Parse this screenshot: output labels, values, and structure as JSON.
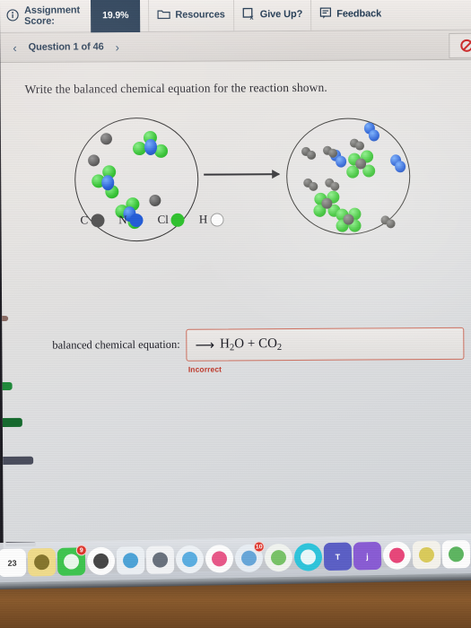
{
  "toolbar": {
    "info_icon": "info-circle-icon",
    "score_label_line1": "Assignment",
    "score_label_line2": "Score:",
    "score_value": "19.9%",
    "resources_icon": "folder-icon",
    "resources_label": "Resources",
    "giveup_icon": "square-x-icon",
    "giveup_label": "Give Up?",
    "feedback_icon": "speech-bubble-icon",
    "feedback_label": "Feedback"
  },
  "question_bar": {
    "prev_icon": "chevron-left-icon",
    "next_icon": "chevron-right-icon",
    "label": "Question 1 of 46",
    "status_icon": "no-entry-icon"
  },
  "question": {
    "prompt": "Write the balanced chemical equation for the reaction shown."
  },
  "legend": [
    {
      "symbol": "C",
      "color": "#4a4a4a"
    },
    {
      "symbol": "N",
      "color": "#1553d6"
    },
    {
      "symbol": "Cl",
      "color": "#24c024"
    },
    {
      "symbol": "H",
      "color": "#ffffff"
    }
  ],
  "diagram": {
    "arrow": "reaction-arrow",
    "reactant_beaker": "reactants-container",
    "product_beaker": "products-container"
  },
  "answer": {
    "label": "balanced chemical equation:",
    "arrow_glyph": "⟶",
    "value_parts": [
      "H",
      "2",
      "O + CO",
      "2"
    ],
    "value_plain": "⟶ H2O + CO2",
    "placeholder": "",
    "feedback": "Incorrect",
    "feedback_color": "#c0392b",
    "border_color": "#d0705f"
  },
  "dock": [
    {
      "name": "calendar-icon",
      "label": "23",
      "bg": "#ffffff",
      "fg": "#333333",
      "badge": ""
    },
    {
      "name": "notes-icon",
      "label": "",
      "bg": "#f2dd8c",
      "fg": "#7a6a22",
      "badge": ""
    },
    {
      "name": "facetime-icon",
      "label": "",
      "bg": "#3ec64f",
      "fg": "#ffffff",
      "badge": "9"
    },
    {
      "name": "chrome-icon",
      "label": "",
      "bg": "#ffffff",
      "fg": "#333333",
      "badge": ""
    },
    {
      "name": "preview-icon",
      "label": "",
      "bg": "#eef2f6",
      "fg": "#3b9bd6",
      "badge": ""
    },
    {
      "name": "launchpad-icon",
      "label": "",
      "bg": "#f4f5f7",
      "fg": "#5b6470",
      "badge": ""
    },
    {
      "name": "twitter-icon",
      "label": "",
      "bg": "#f0f4f8",
      "fg": "#4aa7e0",
      "badge": ""
    },
    {
      "name": "music-icon",
      "label": "",
      "bg": "#ffffff",
      "fg": "#e8467c",
      "badge": ""
    },
    {
      "name": "photos-icon",
      "label": "",
      "bg": "#eaf0f6",
      "fg": "#5aa0d8",
      "badge": "10"
    },
    {
      "name": "labs-icon",
      "label": "",
      "bg": "#f3f6f2",
      "fg": "#6bbf59",
      "badge": ""
    },
    {
      "name": "messenger-icon",
      "label": "",
      "bg": "#2ec6dd",
      "fg": "#ffffff",
      "badge": ""
    },
    {
      "name": "teams-icon",
      "label": "T",
      "bg": "#5b5fc7",
      "fg": "#ffffff",
      "badge": ""
    },
    {
      "name": "jira-icon",
      "label": "j",
      "bg": "#8a5cd6",
      "fg": "#ffffff",
      "badge": ""
    },
    {
      "name": "news-icon",
      "label": "",
      "bg": "#ffffff",
      "fg": "#e8336d",
      "badge": ""
    },
    {
      "name": "stickies-icon",
      "label": "",
      "bg": "#f7f5ee",
      "fg": "#d8c84a",
      "badge": ""
    },
    {
      "name": "numbers-icon",
      "label": "",
      "bg": "#ffffff",
      "fg": "#4caf50",
      "badge": ""
    },
    {
      "name": "keynote-icon",
      "label": "",
      "bg": "#f5f3e9",
      "fg": "#2e9b5a",
      "badge": ""
    }
  ]
}
